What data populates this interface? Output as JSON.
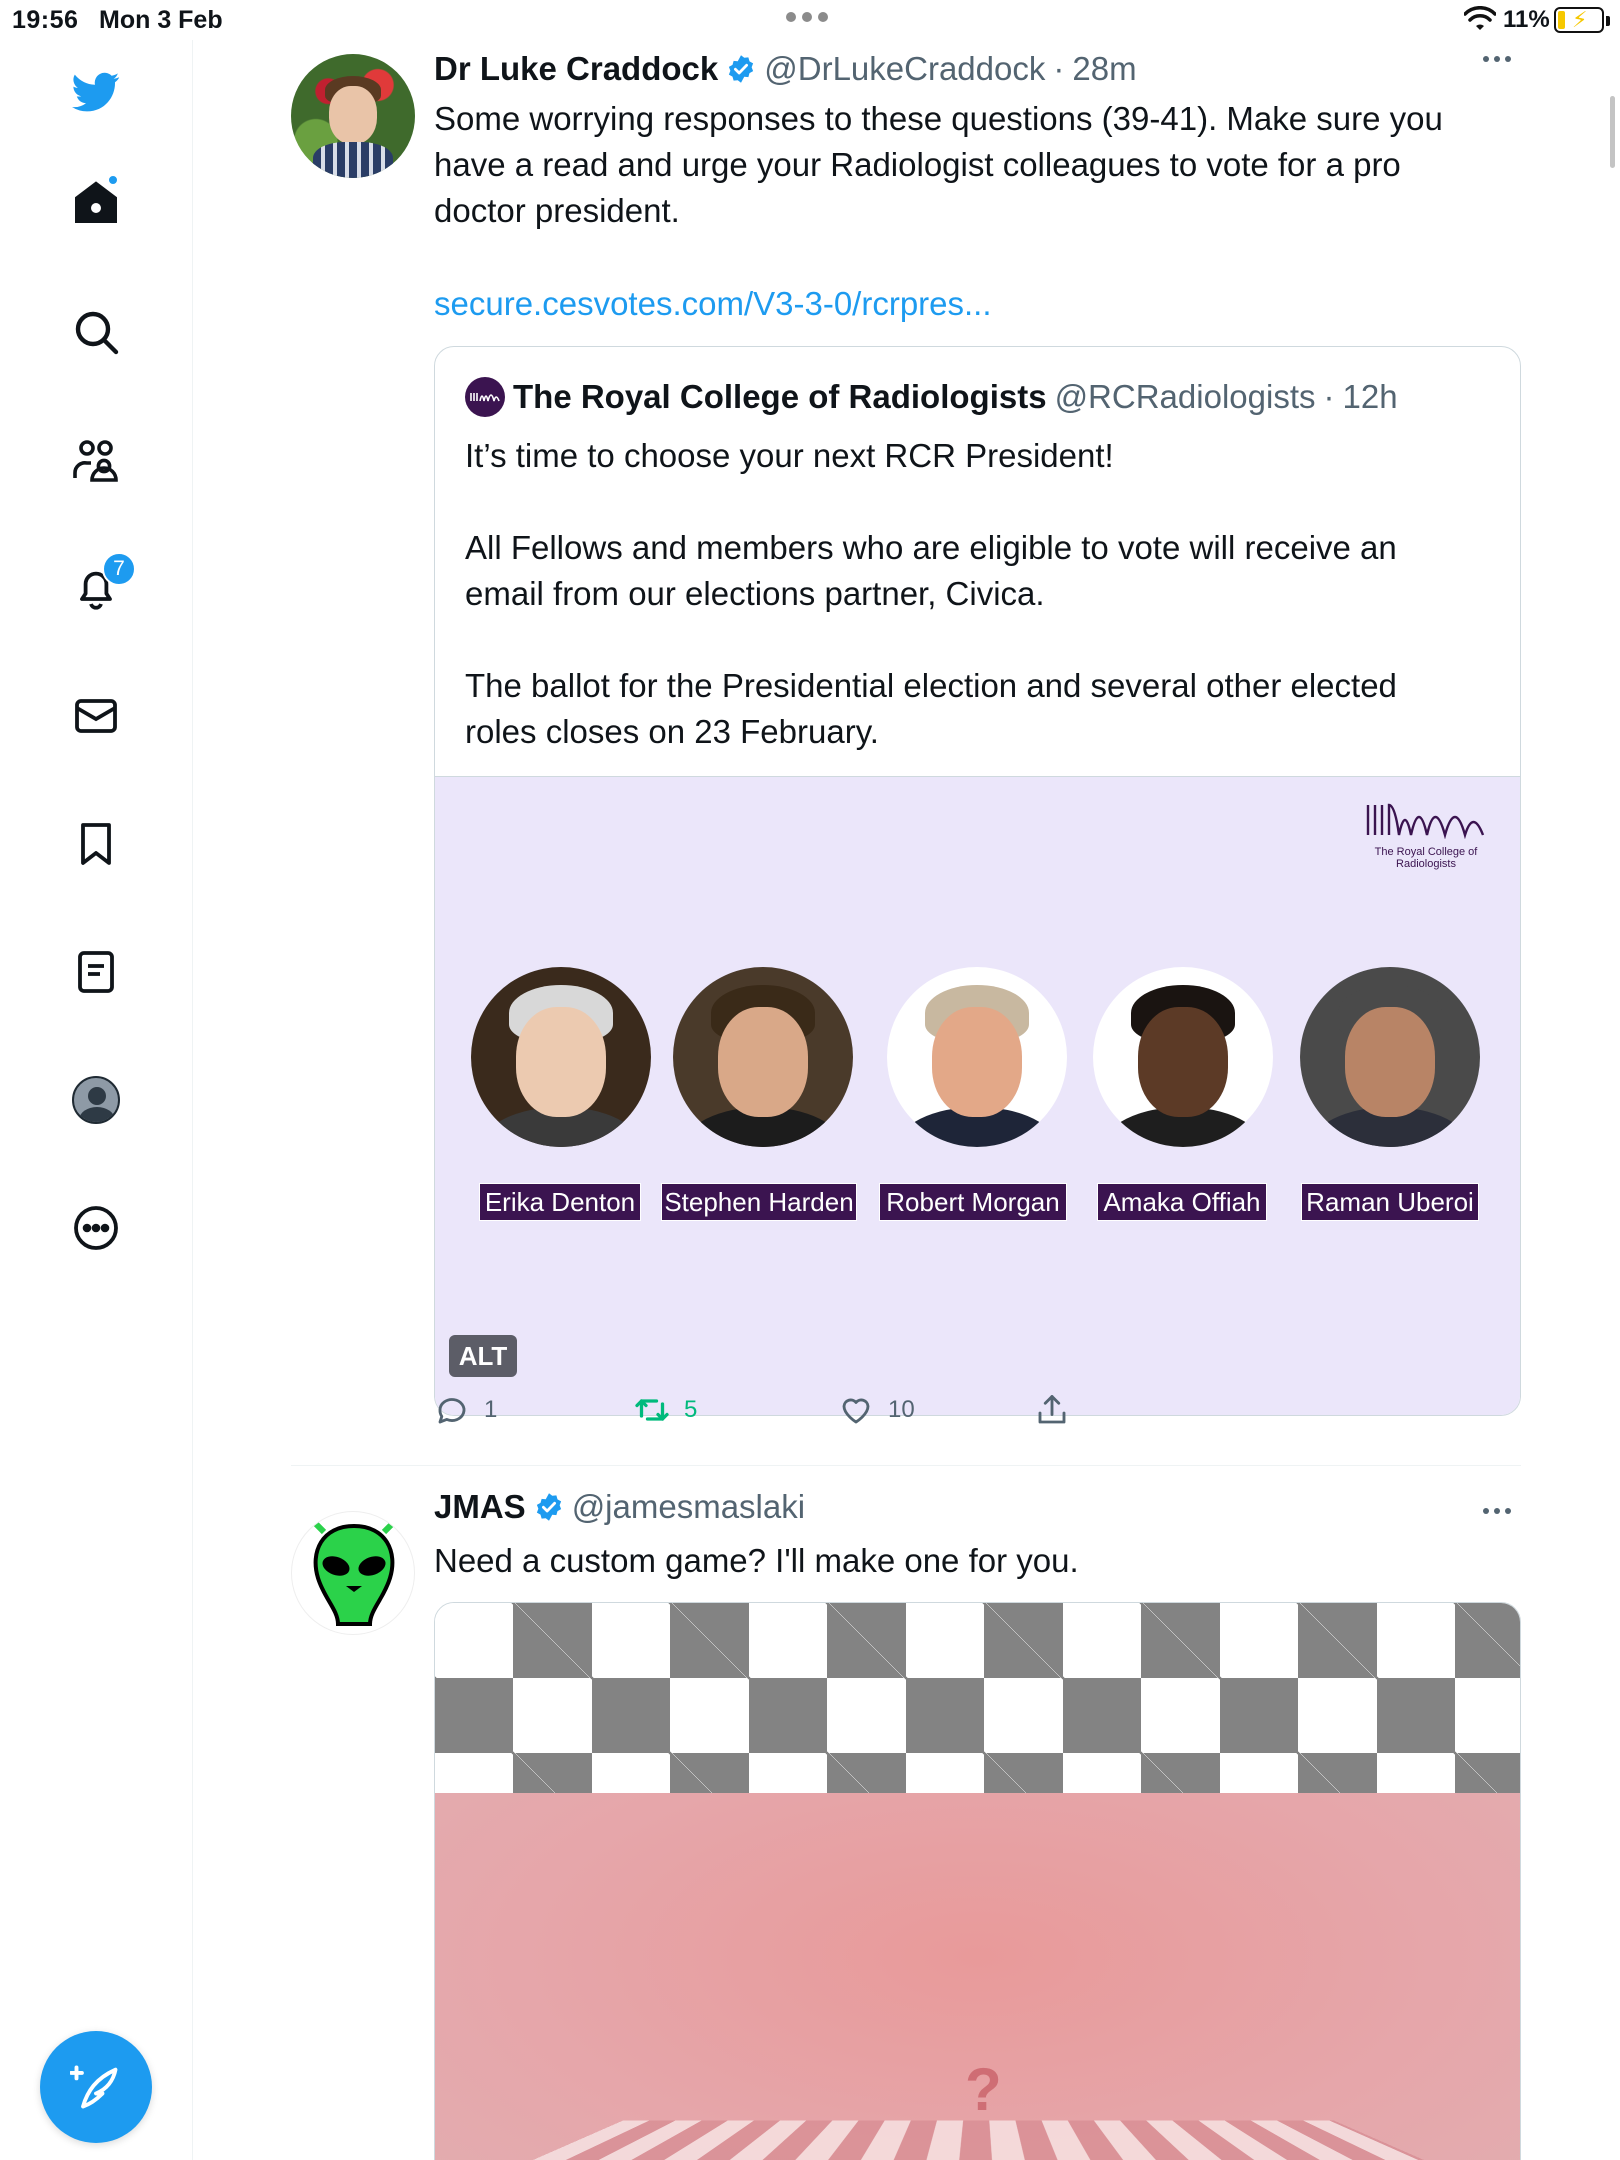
{
  "status_bar": {
    "time": "19:56",
    "date": "Mon 3 Feb",
    "battery_percent": "11%"
  },
  "sidebar": {
    "items": [
      {
        "name": "bird-icon"
      },
      {
        "name": "home-icon"
      },
      {
        "name": "search-icon"
      },
      {
        "name": "communities-icon"
      },
      {
        "name": "notifications-icon",
        "badge": "7"
      },
      {
        "name": "messages-icon"
      },
      {
        "name": "bookmarks-icon"
      },
      {
        "name": "lists-icon"
      },
      {
        "name": "profile-icon"
      },
      {
        "name": "more-icon"
      }
    ],
    "compose_icon": "compose-tweet-icon"
  },
  "colors": {
    "accent": "#1d9bf0",
    "retweet": "#00ba7c",
    "rcr_purple": "#3b1450",
    "secondary_text": "#536471"
  },
  "tweets": [
    {
      "name": "Dr Luke Craddock",
      "handle": "@DrLukeCraddock",
      "separator": "·",
      "time": "28m",
      "text_line1": "Some worrying responses to these questions (39-41). Make sure you",
      "text_line2": "have a read and urge your Radiologist colleagues to vote for a pro",
      "text_line3": "doctor president.",
      "link": "secure.cesvotes.com/V3-3-0/rcrpres...",
      "quote": {
        "name": "The Royal College of Radiologists",
        "handle": "@RCRadiologists",
        "separator": "·",
        "time": "12h",
        "para1": "It’s time to choose your next RCR President!",
        "para2_line1": "All Fellows and members who are eligible to vote will receive an",
        "para2_line2": "email from our elections partner, Civica.",
        "para3_line1": "The ballot for the Presidential election and several other elected",
        "para3_line2": "roles closes on 23 February.",
        "media": {
          "logo_caption": "The Royal College of Radiologists",
          "candidates": [
            "Erika Denton",
            "Stephen Harden",
            "Robert Morgan",
            "Amaka Offiah",
            "Raman Uberoi"
          ],
          "alt_badge": "ALT"
        }
      },
      "actions": {
        "replies": "1",
        "retweets": "5",
        "likes": "10"
      }
    },
    {
      "name": "JMAS",
      "handle": "@jamesmaslaki",
      "text": "Need a custom game? I'll make one for you."
    }
  ]
}
